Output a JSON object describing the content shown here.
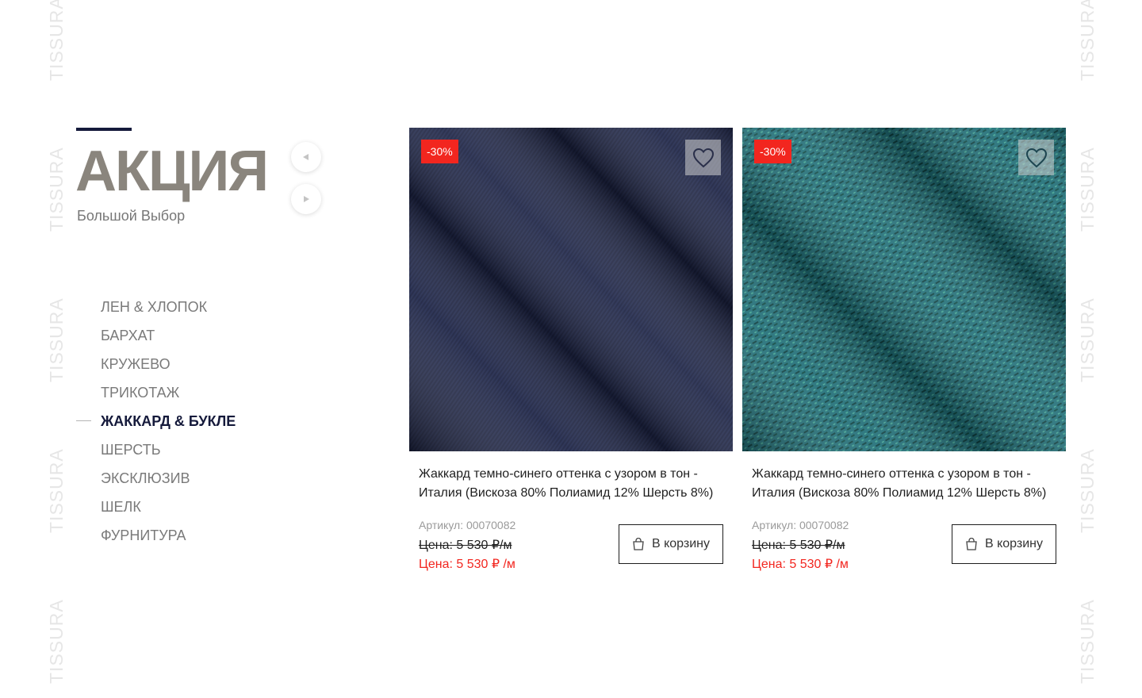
{
  "watermark": "TISSURA",
  "section": {
    "title": "АКЦИЯ",
    "subtitle": "Большой Выбор"
  },
  "slider": {
    "prev_icon": "triangle-left-icon",
    "next_icon": "triangle-right-icon"
  },
  "categories": [
    {
      "label": "ЛЕН & ХЛОПОК",
      "active": false
    },
    {
      "label": "БАРХАТ",
      "active": false
    },
    {
      "label": "КРУЖЕВО",
      "active": false
    },
    {
      "label": "ТРИКОТАЖ",
      "active": false
    },
    {
      "label": "ЖАККАРД & БУКЛЕ",
      "active": true
    },
    {
      "label": "ШЕРСТЬ",
      "active": false
    },
    {
      "label": "ЭКСКЛЮЗИВ",
      "active": false
    },
    {
      "label": "ШЕЛК",
      "active": false
    },
    {
      "label": "ФУРНИТУРА",
      "active": false
    }
  ],
  "products": [
    {
      "badge": "-30%",
      "name": "Жаккард темно-синего оттенка с узором в тон - Италия (Вискоза 80% Полиамид 12% Шерсть 8%)",
      "sku": "Артикул: 00070082",
      "old_price": "Цена: 5 530 ₽/м",
      "new_price": "Цена: 5 530 ₽ /м",
      "cart_label": "В корзину",
      "fabric_color": "#1b2140"
    },
    {
      "badge": "-30%",
      "name": "Жаккард темно-синего оттенка с узором в тон - Италия (Вискоза 80% Полиамид 12% Шерсть 8%)",
      "sku": "Артикул: 00070082",
      "old_price": "Цена: 5 530 ₽/м",
      "new_price": "Цена: 5 530 ₽ /м",
      "cart_label": "В корзину",
      "fabric_color": "#1f6e77"
    }
  ],
  "colors": {
    "accent_dark": "#151a3b",
    "sale_red": "#f2261f",
    "title_gray": "#8a857d"
  }
}
